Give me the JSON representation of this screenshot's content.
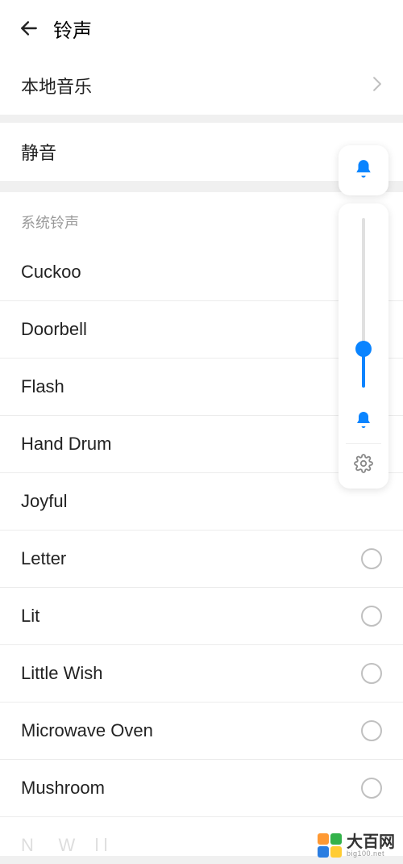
{
  "header": {
    "title": "铃声"
  },
  "local_music": {
    "label": "本地音乐"
  },
  "silent": {
    "label": "静音"
  },
  "system_ringtones": {
    "header": "系统铃声",
    "items": [
      {
        "label": "Cuckoo",
        "radio_visible": false
      },
      {
        "label": "Doorbell",
        "radio_visible": false
      },
      {
        "label": "Flash",
        "radio_visible": false
      },
      {
        "label": "Hand Drum",
        "radio_visible": false
      },
      {
        "label": "Joyful",
        "radio_visible": false
      },
      {
        "label": "Letter",
        "radio_visible": true
      },
      {
        "label": "Lit",
        "radio_visible": true
      },
      {
        "label": "Little Wish",
        "radio_visible": true
      },
      {
        "label": "Microwave Oven",
        "radio_visible": true
      },
      {
        "label": "Mushroom",
        "radio_visible": true
      }
    ],
    "cutoff_item": "New World"
  },
  "volume_panel": {
    "slider_percent": 23
  },
  "watermark": {
    "text": "大百网",
    "subtext": "big100.net",
    "colors": [
      "#ff9933",
      "#33b24a",
      "#2a7de1",
      "#ffcc33"
    ]
  }
}
